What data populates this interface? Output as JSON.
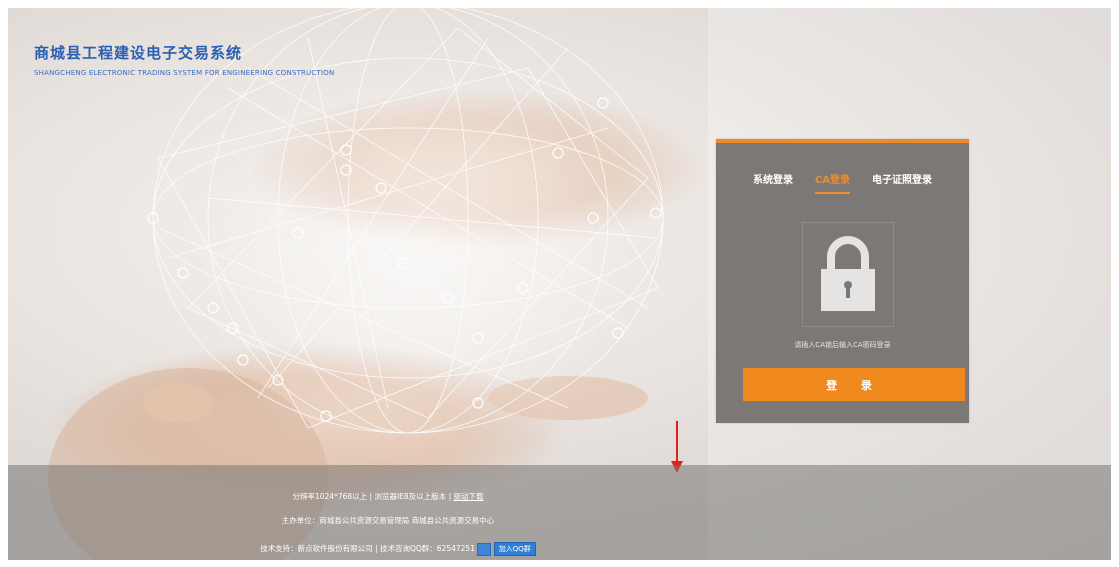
{
  "brand": {
    "title": "商城县工程建设电子交易系统",
    "subtitle": "SHANGCHENG ELECTRONIC TRADING SYSTEM FOR ENGINEERING CONSTRUCTION"
  },
  "login": {
    "tabs": [
      {
        "label": "系统登录",
        "active": false
      },
      {
        "label": "CA登录",
        "active": true
      },
      {
        "label": "电子证照登录",
        "active": false
      }
    ],
    "hint": "请插入CA锁后输入CA密码登录",
    "button_label": "登 录",
    "lock_icon": "lock-icon"
  },
  "footer": {
    "row1": {
      "part1": "分辨率1024*768以上",
      "part2": "浏览器IE8及以上版本",
      "link": "驱动下载"
    },
    "row2": {
      "part1": "主办单位：商城县公共资源交易管理局",
      "part2": "商城县公共资源交易中心"
    },
    "row3": {
      "part1": "技术支持：新点软件股份有限公司",
      "part2": "技术咨询QQ群：62547251",
      "qq_button": "加入QQ群"
    }
  },
  "colors": {
    "accent": "#f0891d",
    "brand_blue": "#2b5fb0",
    "panel_gray": "#7b7876"
  }
}
